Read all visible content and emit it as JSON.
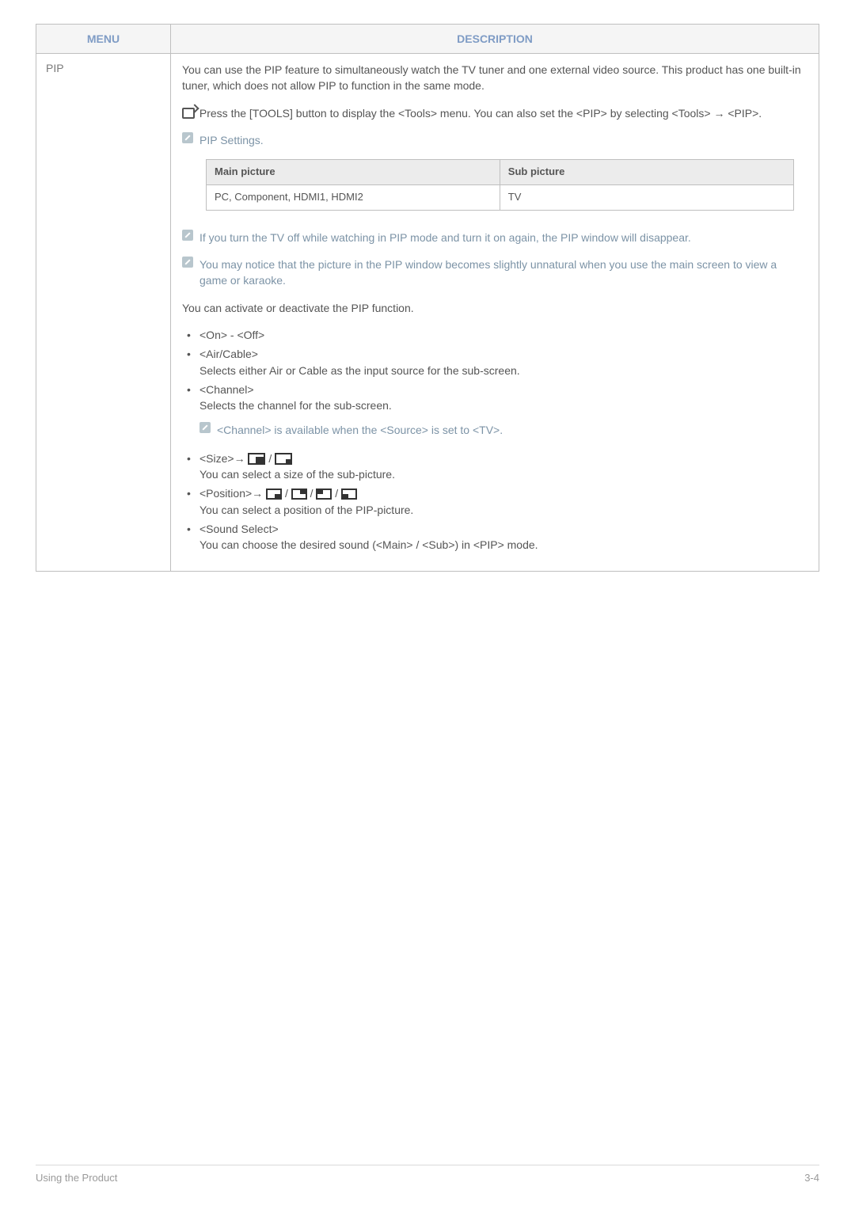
{
  "header": {
    "menu": "MENU",
    "description": "DESCRIPTION"
  },
  "row": {
    "menu_label": "PIP",
    "intro": "You can use the PIP feature to simultaneously watch the TV tuner and one external video source. This product has one built-in tuner, which does not allow PIP to function in the same mode.",
    "tools_note": "Press the [TOOLS] button to display the <Tools> menu. You can also set the <PIP> by selecting <Tools> → <PIP>.",
    "pip_settings_label": "PIP Settings.",
    "sub_headers": {
      "main": "Main picture",
      "sub": "Sub picture"
    },
    "sub_row": {
      "main": "PC, Component, HDMI1, HDMI2",
      "sub": "TV"
    },
    "note_off": "If you turn the TV off while watching in PIP mode and turn it on again, the PIP window will disappear.",
    "note_unnatural": "You may notice that the picture in the PIP window becomes slightly unnatural when you use the main screen to view a game or karaoke.",
    "activate_text": "You can activate or deactivate the PIP function.",
    "bullet_onoff": "<On> - <Off>",
    "bullet_aircable_title": "<Air/Cable>",
    "bullet_aircable_desc": "Selects either Air or Cable as the input source for the sub-screen.",
    "bullet_channel_title": "<Channel>",
    "bullet_channel_desc": "Selects the channel for the sub-screen.",
    "channel_note": "<Channel> is available when the <Source> is set to <TV>.",
    "bullet_size_prefix": "<Size>→",
    "bullet_size_desc": "You can select a size of the sub-picture.",
    "bullet_position_prefix": "<Position>→",
    "bullet_position_desc": "You can select a position of the PIP-picture.",
    "bullet_sound_title": "<Sound Select>",
    "bullet_sound_desc": "You can choose the desired sound (<Main> / <Sub>) in <PIP> mode."
  },
  "footer": {
    "left": "Using the Product",
    "right": "3-4"
  }
}
